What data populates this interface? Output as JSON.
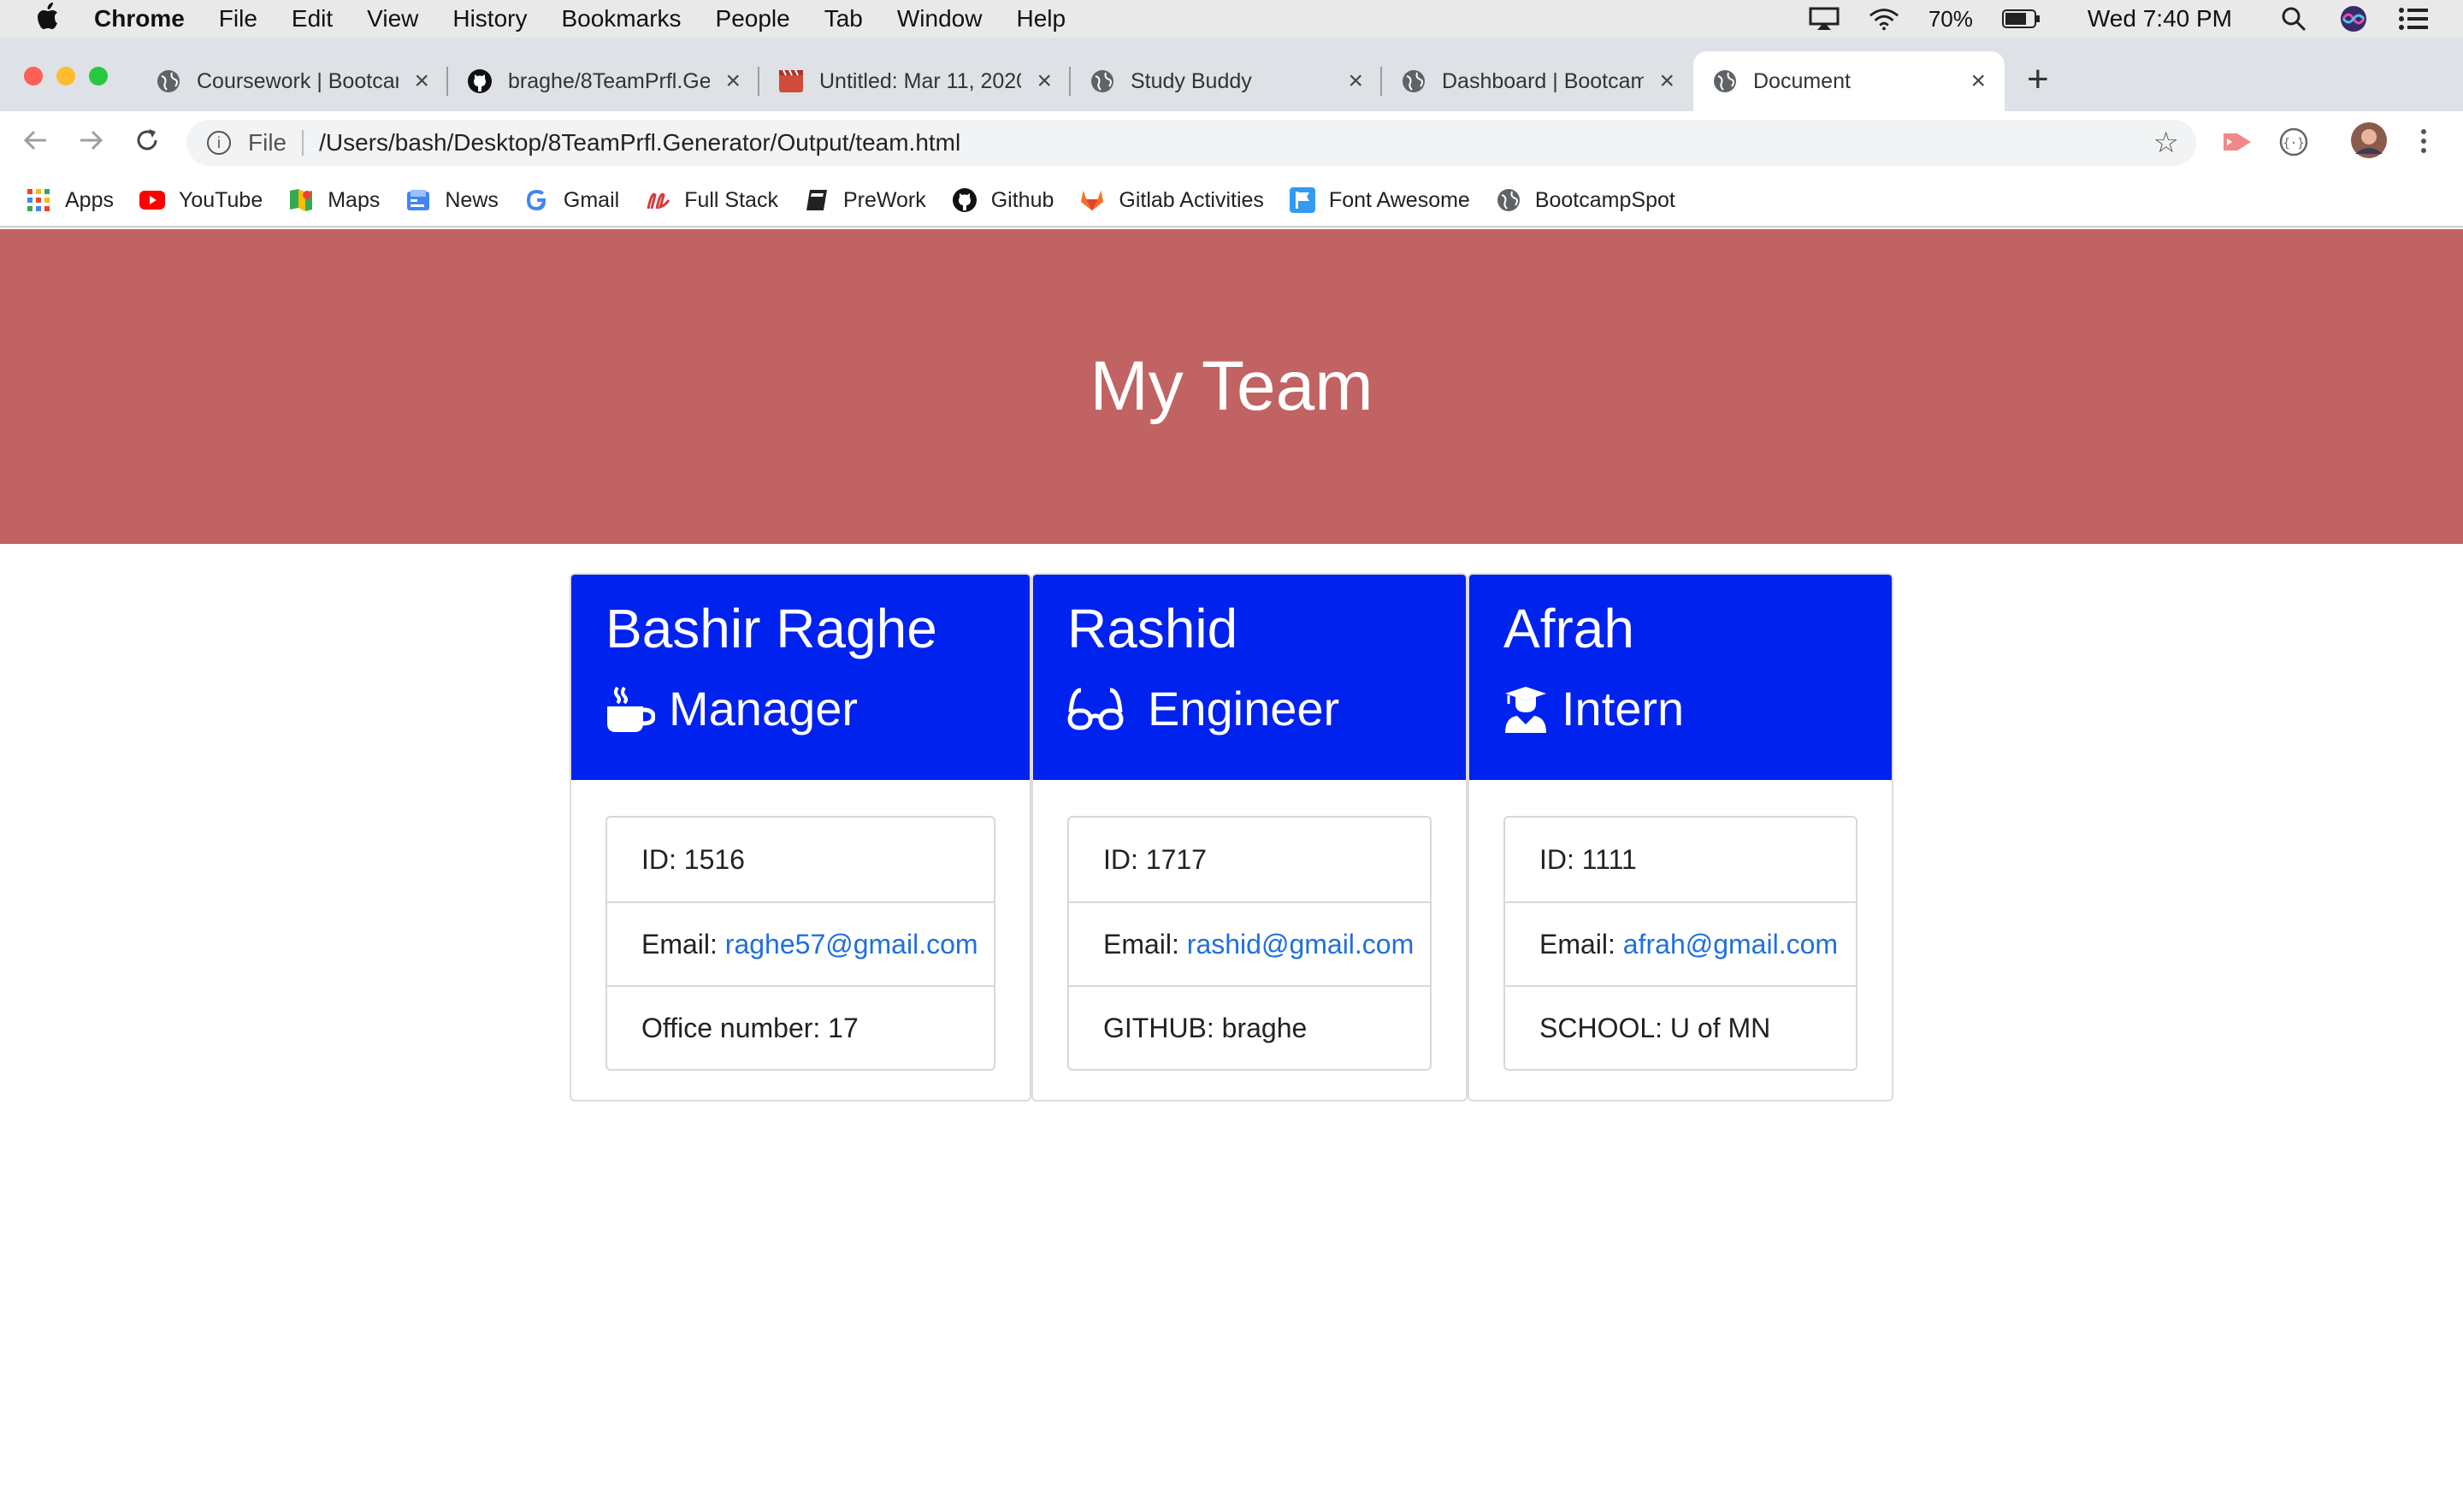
{
  "menubar": {
    "app": "Chrome",
    "items": [
      "File",
      "Edit",
      "View",
      "History",
      "Bookmarks",
      "People",
      "Tab",
      "Window",
      "Help"
    ],
    "battery": "70%",
    "clock": "Wed 7:40 PM"
  },
  "tabs": [
    {
      "title": "Coursework | Bootcamp",
      "icon": "globe-icon"
    },
    {
      "title": "braghe/8TeamPrfl.Generator",
      "icon": "github-icon"
    },
    {
      "title": "Untitled: Mar 11, 2020",
      "icon": "clapper-icon"
    },
    {
      "title": "Study Buddy",
      "icon": "globe-icon"
    },
    {
      "title": "Dashboard | Bootcamp",
      "icon": "globe-icon"
    },
    {
      "title": "Document",
      "icon": "globe-icon",
      "active": true
    }
  ],
  "address": {
    "scheme": "File",
    "url": "/Users/bash/Desktop/8TeamPrfl.Generator/Output/team.html"
  },
  "bookmarks": [
    {
      "label": "Apps",
      "icon": "apps-grid-icon"
    },
    {
      "label": "YouTube",
      "icon": "youtube-icon"
    },
    {
      "label": "Maps",
      "icon": "maps-icon"
    },
    {
      "label": "News",
      "icon": "news-icon"
    },
    {
      "label": "Gmail",
      "icon": "google-icon"
    },
    {
      "label": "Full Stack",
      "icon": "fullstack-icon"
    },
    {
      "label": "PreWork",
      "icon": "book-icon"
    },
    {
      "label": "Github",
      "icon": "github-icon"
    },
    {
      "label": "Gitlab Activities",
      "icon": "gitlab-icon"
    },
    {
      "label": "Font Awesome",
      "icon": "flag-icon"
    },
    {
      "label": "BootcampSpot",
      "icon": "globe-icon"
    }
  ],
  "page": {
    "title": "My Team",
    "colors": {
      "jumbotron": "#c16362",
      "card_header": "#0022ee",
      "link": "#1f6fe0"
    },
    "members": [
      {
        "name": "Bashir Raghe",
        "role": "Manager",
        "icon": "coffee-icon",
        "id": "ID: 1516",
        "email_label": "Email: ",
        "email": "raghe57@gmail.com",
        "extra": "Office number: 17"
      },
      {
        "name": "Rashid",
        "role": "Engineer",
        "icon": "glasses-icon",
        "id": "ID: 1717",
        "email_label": "Email: ",
        "email": "rashid@gmail.com",
        "extra": "GITHUB: braghe"
      },
      {
        "name": "Afrah",
        "role": "Intern",
        "icon": "graduate-icon",
        "id": "ID: 1111",
        "email_label": "Email: ",
        "email": "afrah@gmail.com",
        "extra": "SCHOOL: U of MN"
      }
    ]
  }
}
